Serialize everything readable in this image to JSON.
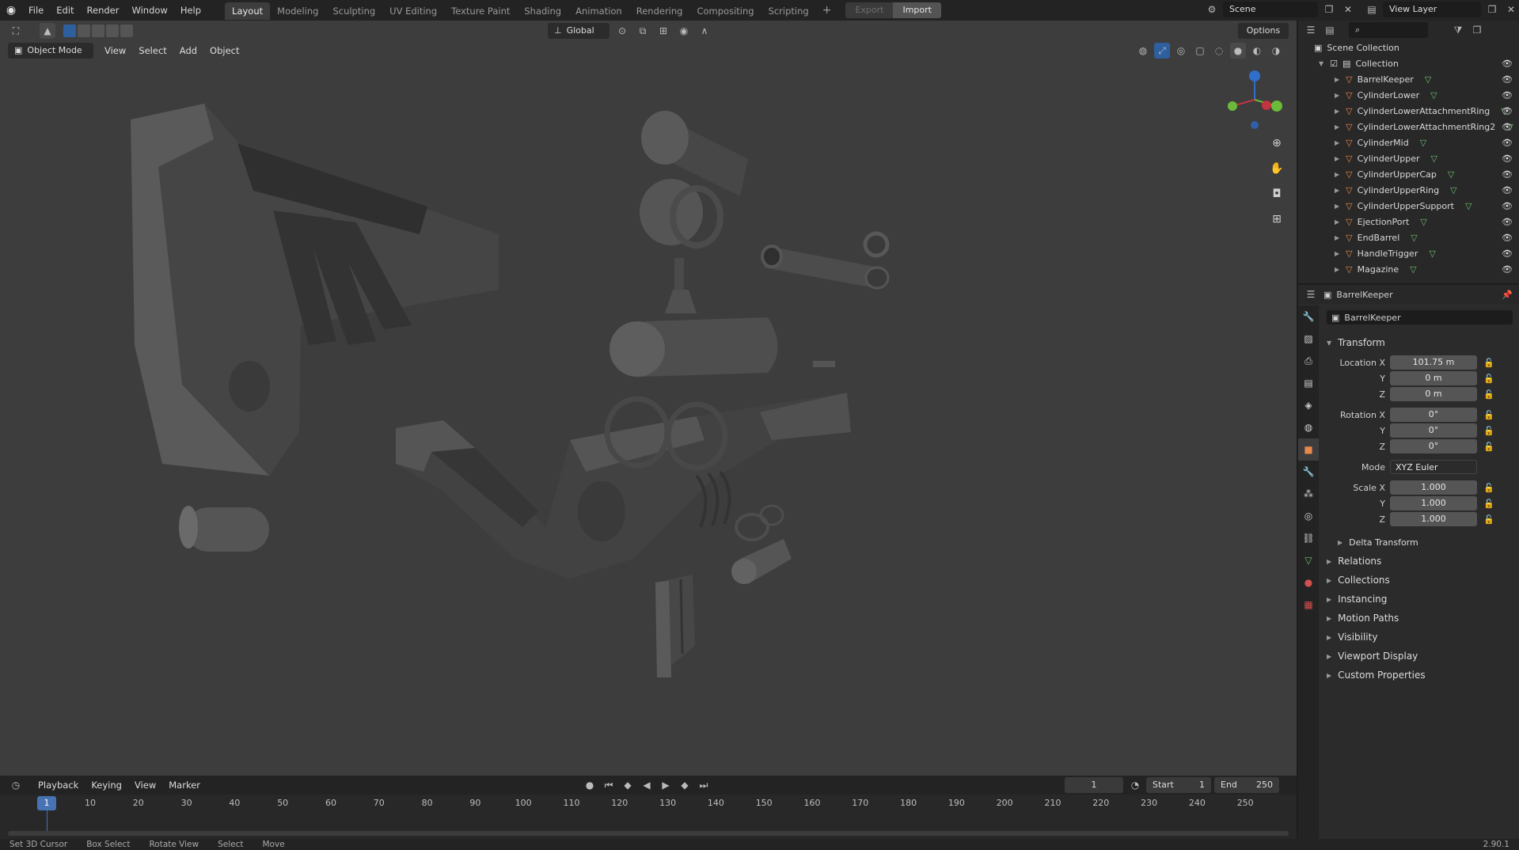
{
  "menu": [
    "File",
    "Edit",
    "Render",
    "Window",
    "Help"
  ],
  "workspaces": [
    "Layout",
    "Modeling",
    "Sculpting",
    "UV Editing",
    "Texture Paint",
    "Shading",
    "Animation",
    "Rendering",
    "Compositing",
    "Scripting"
  ],
  "active_workspace": "Layout",
  "export_label": "Export",
  "import_label": "Import",
  "scene_name": "Scene",
  "view_layer": "View Layer",
  "viewport": {
    "mode": "Object Mode",
    "menus": [
      "View",
      "Select",
      "Add",
      "Object"
    ],
    "orientation": "Global",
    "options_label": "Options"
  },
  "outliner": {
    "root": "Scene Collection",
    "collection": "Collection",
    "items": [
      "BarrelKeeper",
      "CylinderLower",
      "CylinderLowerAttachmentRing",
      "CylinderLowerAttachmentRing2",
      "CylinderMid",
      "CylinderUpper",
      "CylinderUpperCap",
      "CylinderUpperRing",
      "CylinderUpperSupport",
      "EjectionPort",
      "EndBarrel",
      "HandleTrigger",
      "Magazine"
    ]
  },
  "properties": {
    "object_name": "BarrelKeeper",
    "data_name": "BarrelKeeper",
    "transform_label": "Transform",
    "location_label": "Location X",
    "rotation_label": "Rotation X",
    "scale_label": "Scale X",
    "y_label": "Y",
    "z_label": "Z",
    "location": [
      "101.75 m",
      "0 m",
      "0 m"
    ],
    "rotation": [
      "0°",
      "0°",
      "0°"
    ],
    "mode_label": "Mode",
    "mode_value": "XYZ Euler",
    "scale": [
      "1.000",
      "1.000",
      "1.000"
    ],
    "delta_transform": "Delta Transform",
    "sections": [
      "Relations",
      "Collections",
      "Instancing",
      "Motion Paths",
      "Visibility",
      "Viewport Display",
      "Custom Properties"
    ]
  },
  "timeline": {
    "menus": [
      "Playback",
      "Keying",
      "View",
      "Marker"
    ],
    "current_frame": "1",
    "start_label": "Start",
    "start": "1",
    "end_label": "End",
    "end": "250",
    "ticks": [
      "10",
      "20",
      "30",
      "40",
      "50",
      "60",
      "70",
      "80",
      "90",
      "100",
      "110",
      "120",
      "130",
      "140",
      "150",
      "160",
      "170",
      "180",
      "190",
      "200",
      "210",
      "220",
      "230",
      "240",
      "250"
    ]
  },
  "status": {
    "hints": [
      "Set 3D Cursor",
      "Box Select",
      "Rotate View",
      "Select",
      "Move"
    ],
    "version": "2.90.1"
  },
  "colors": {
    "accent": "#4772b3",
    "viewport_bg": "#3d3d3d",
    "panel_bg": "#2b2b2b"
  }
}
